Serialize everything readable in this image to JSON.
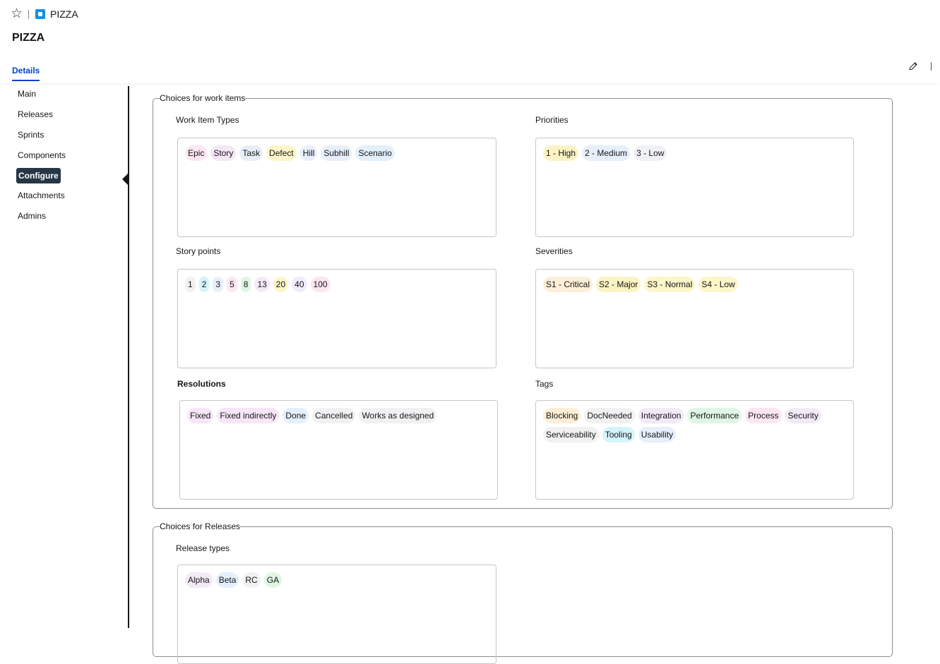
{
  "header": {
    "breadcrumb": "PIZZA",
    "page_title": "PIZZA"
  },
  "tabs": [
    {
      "label": "Details"
    }
  ],
  "sidebar": {
    "items": [
      {
        "label": "Main"
      },
      {
        "label": "Releases"
      },
      {
        "label": "Sprints"
      },
      {
        "label": "Components"
      },
      {
        "label": "Configure"
      },
      {
        "label": "Attachments"
      },
      {
        "label": "Admins"
      }
    ],
    "active_item": "Configure"
  },
  "colors": {
    "pink": "#fbe6f2",
    "lavender": "#f1eafb",
    "blue": "#e6effb",
    "yellow": "#fcf6c8",
    "orange": "#fdefd7",
    "teal": "#d5f3fa",
    "green": "#dff6e4",
    "gray": "#f0f1f4",
    "accent": "#0043ce",
    "active_nav": "#263645"
  },
  "work_items": {
    "legend": "Choices for work items",
    "work_item_types": {
      "label": "Work Item Types",
      "chips": [
        {
          "text": "Epic",
          "color": "#fbe6f2"
        },
        {
          "text": "Story",
          "color": "#f6e6f7"
        },
        {
          "text": "Task",
          "color": "#e7eef8"
        },
        {
          "text": "Defect",
          "color": "#fcf6c8"
        },
        {
          "text": "Hill",
          "color": "#e6effb"
        },
        {
          "text": "Subhill",
          "color": "#e6effb"
        },
        {
          "text": "Scenario",
          "color": "#e3f0fb"
        }
      ]
    },
    "priorities": {
      "label": "Priorities",
      "chips": [
        {
          "text": "1 - High",
          "color": "#fcf3c4"
        },
        {
          "text": "2 - Medium",
          "color": "#e6effb"
        },
        {
          "text": "3 - Low",
          "color": "#f0f1f4"
        }
      ]
    },
    "story_points": {
      "label": "Story points",
      "chips": [
        {
          "text": "1",
          "color": "#f1f1f5"
        },
        {
          "text": "2",
          "color": "#d5f3fa"
        },
        {
          "text": "3",
          "color": "#e9eefa"
        },
        {
          "text": "5",
          "color": "#fbe6f2"
        },
        {
          "text": "8",
          "color": "#dff6e4"
        },
        {
          "text": "13",
          "color": "#f3eaf8"
        },
        {
          "text": "20",
          "color": "#fcf6c8"
        },
        {
          "text": "40",
          "color": "#f1eafb"
        },
        {
          "text": "100",
          "color": "#fbe6f2"
        }
      ]
    },
    "severities": {
      "label": "Severities",
      "chips": [
        {
          "text": "S1 - Critical",
          "color": "#fdefd7"
        },
        {
          "text": "S2 - Major",
          "color": "#fcf3c4"
        },
        {
          "text": "S3 - Normal",
          "color": "#fcf6c8"
        },
        {
          "text": "S4 - Low",
          "color": "#fcf6c8"
        }
      ]
    },
    "resolutions": {
      "label": "Resolutions",
      "chips": [
        {
          "text": "Fixed",
          "color": "#f6e6f7"
        },
        {
          "text": "Fixed indirectly",
          "color": "#f6e6f7"
        },
        {
          "text": "Done",
          "color": "#e3f0fb"
        },
        {
          "text": "Cancelled",
          "color": "#f1f1f3"
        },
        {
          "text": "Works as designed",
          "color": "#f1f1f3"
        }
      ]
    },
    "tags": {
      "label": "Tags",
      "chips": [
        {
          "text": "Blocking",
          "color": "#fdefd7"
        },
        {
          "text": "DocNeeded",
          "color": "#f1f1f3"
        },
        {
          "text": "Integration",
          "color": "#f3eaf8"
        },
        {
          "text": "Performance",
          "color": "#dff6e4"
        },
        {
          "text": "Process",
          "color": "#fbe6f2"
        },
        {
          "text": "Security",
          "color": "#f3eaf8"
        },
        {
          "text": "Serviceability",
          "color": "#f1f1f3"
        },
        {
          "text": "Tooling",
          "color": "#d5f3fa"
        },
        {
          "text": "Usability",
          "color": "#e6effb"
        }
      ]
    }
  },
  "releases": {
    "legend": "Choices for Releases",
    "release_types": {
      "label": "Release types",
      "chips": [
        {
          "text": "Alpha",
          "color": "#f3eaf8"
        },
        {
          "text": "Beta",
          "color": "#e3f0fb"
        },
        {
          "text": "RC",
          "color": "#f1f1f3"
        },
        {
          "text": "GA",
          "color": "#dff6e4"
        }
      ]
    }
  }
}
